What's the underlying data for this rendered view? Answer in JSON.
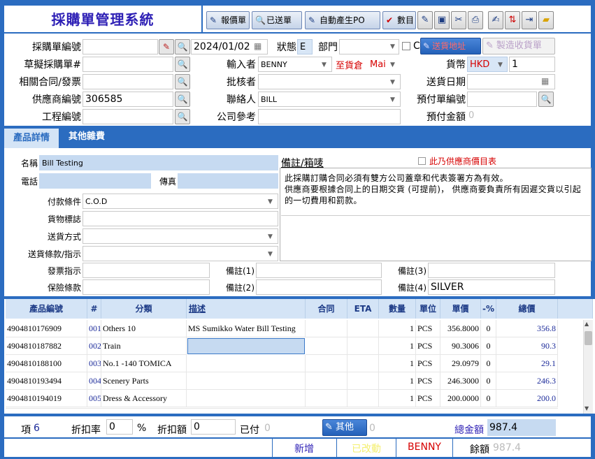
{
  "app": {
    "title": "採購單管理系統"
  },
  "toolbar": {
    "quote_label": "報價單",
    "shipped_label": "已送單",
    "auto_po_label": "自動產生PO",
    "confirm_label": "數目"
  },
  "form": {
    "po_no_label": "採購單編號",
    "po_no": "",
    "date": "2024/01/02",
    "status_label": "狀態",
    "status": "E",
    "dept_label": "部門",
    "dept": "",
    "c_label": "C",
    "ship_addr_label": "送貨地址",
    "make_receipt_label": "製造收貨單",
    "draft_label": "草擬採購單#",
    "draft": "",
    "entered_by_label": "輸入者",
    "entered_by": "BENNY",
    "to_wh_label": "至貨倉",
    "to_wh": "Mai",
    "currency_label": "貨幣",
    "currency": "HKD",
    "rate": "1",
    "contract_label": "相關合同/發票",
    "contract": "",
    "approver_label": "批核者",
    "approver": "",
    "delivery_date_label": "送貨日期",
    "delivery_date": "",
    "supplier_label": "供應商編號",
    "supplier": "306585",
    "contact_label": "聯絡人",
    "contact": "BILL",
    "prepay_no_label": "預付單編號",
    "prepay_no": "",
    "project_label": "工程編號",
    "project": "",
    "company_ref_label": "公司參考",
    "company_ref": "",
    "prepay_amt_label": "預付金額",
    "prepay_amt": "0"
  },
  "tabs": [
    {
      "label": "產品詳情"
    },
    {
      "label": "其他雜費"
    }
  ],
  "details": {
    "name_label": "名稱",
    "name": "Bill Testing",
    "phone_label": "電話",
    "phone": "",
    "fax_label": "傳真",
    "fax": "",
    "payment_label": "付款條件",
    "payment": "C.O.D",
    "goods_mark_label": "貨物標誌",
    "goods_mark": "",
    "ship_method_label": "送貨方式",
    "ship_method": "",
    "ship_terms_label": "送貨條款/指示",
    "ship_terms": "",
    "invoice_instr_label": "發票指示",
    "invoice_instr": "",
    "insurance_label": "保險條款",
    "insurance": "",
    "remark1_label": "備註(1)",
    "remark1": "",
    "remark2_label": "備註(2)",
    "remark2": "",
    "remark3_label": "備註(3)",
    "remark3": "",
    "remark4_label": "備註(4)",
    "remark4": "SILVER",
    "notes_label": "備註/箱唛",
    "price_list_label": "此乃供應商價目表",
    "notes_text": "此採購訂購合同必須有雙方公司蓋章和代表簽署方為有效。\n供應商要根據合同上的日期交貨 (可提前)， 供應商要負責所有因遲交貨以引起的一切費用和罰款。"
  },
  "grid": {
    "headers": {
      "code": "產品編號",
      "no": "#",
      "category": "分類",
      "desc": "描述",
      "contract": "合同",
      "eta": "ETA",
      "qty": "數量",
      "unit": "單位",
      "price": "單價",
      "disc": "-%",
      "total": "總價"
    },
    "rows": [
      {
        "code": "4904810176909",
        "no": "001",
        "category": "Others 10",
        "desc": "MS Sumikko Water Bill Testing",
        "qty": "1",
        "unit": "PCS",
        "price": "356.8000",
        "disc": "0",
        "total": "356.8"
      },
      {
        "code": "4904810187882",
        "no": "002",
        "category": "Train",
        "desc": "",
        "qty": "1",
        "unit": "PCS",
        "price": "90.3006",
        "disc": "0",
        "total": "90.3"
      },
      {
        "code": "4904810188100",
        "no": "003",
        "category": "No.1 -140 TOMICA",
        "desc": "",
        "qty": "1",
        "unit": "PCS",
        "price": "29.0979",
        "disc": "0",
        "total": "29.1"
      },
      {
        "code": "4904810193494",
        "no": "004",
        "category": "Scenery Parts",
        "desc": "",
        "qty": "1",
        "unit": "PCS",
        "price": "246.3000",
        "disc": "0",
        "total": "246.3"
      },
      {
        "code": "4904810194019",
        "no": "005",
        "category": "Dress & Accessory",
        "desc": "",
        "qty": "1",
        "unit": "PCS",
        "price": "200.0000",
        "disc": "0",
        "total": "200.0"
      }
    ]
  },
  "footer": {
    "items_label": "項",
    "items": "6",
    "disc_rate_label": "折扣率",
    "disc_rate": "0",
    "percent": "%",
    "disc_amt_label": "折扣額",
    "disc_amt": "0",
    "paid_label": "已付",
    "paid": "0",
    "other_label": "其他",
    "other": "0",
    "total_label": "總金額",
    "total": "987.4",
    "new_label": "新增",
    "changed_label": "已改動",
    "user": "BENNY",
    "balance_label": "餘額",
    "balance": "987.4"
  }
}
